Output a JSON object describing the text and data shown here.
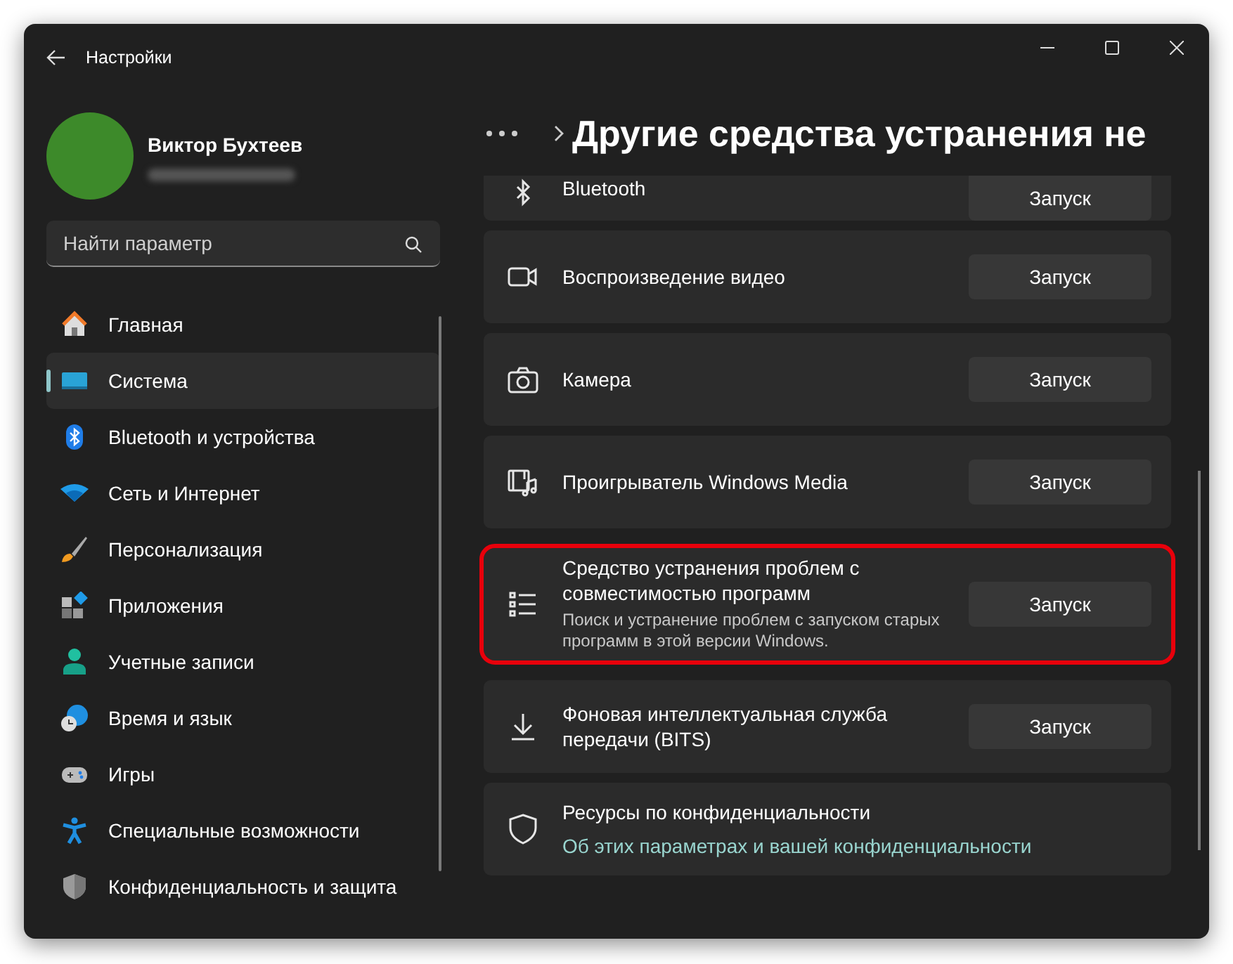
{
  "window": {
    "title": "Настройки"
  },
  "profile": {
    "name": "Виктор Бухтеев"
  },
  "search": {
    "placeholder": "Найти параметр"
  },
  "nav": [
    {
      "label": "Главная",
      "selected": false
    },
    {
      "label": "Система",
      "selected": true
    },
    {
      "label": "Bluetooth и устройства",
      "selected": false
    },
    {
      "label": "Сеть и Интернет",
      "selected": false
    },
    {
      "label": "Персонализация",
      "selected": false
    },
    {
      "label": "Приложения",
      "selected": false
    },
    {
      "label": "Учетные записи",
      "selected": false
    },
    {
      "label": "Время и язык",
      "selected": false
    },
    {
      "label": "Игры",
      "selected": false
    },
    {
      "label": "Специальные возможности",
      "selected": false
    },
    {
      "label": "Конфиденциальность и защита",
      "selected": false
    }
  ],
  "page_title": "Другие средства устранения не",
  "troubleshooters": [
    {
      "kind": "run",
      "title": "Bluetooth",
      "button": "Запуск",
      "highlighted": false
    },
    {
      "kind": "run",
      "title": "Воспроизведение видео",
      "button": "Запуск",
      "highlighted": false
    },
    {
      "kind": "run",
      "title": "Камера",
      "button": "Запуск",
      "highlighted": false
    },
    {
      "kind": "run",
      "title": "Проигрыватель Windows Media",
      "button": "Запуск",
      "highlighted": false
    },
    {
      "kind": "run",
      "title": "Средство устранения проблем с совместимостью программ",
      "description": "Поиск и устранение проблем с запуском старых программ в этой версии Windows.",
      "button": "Запуск",
      "highlighted": true
    },
    {
      "kind": "run",
      "title": "Фоновая интеллектуальная служба передачи (BITS)",
      "button": "Запуск",
      "highlighted": false
    },
    {
      "kind": "link",
      "title": "Ресурсы по конфиденциальности",
      "link": "Об этих параметрах и вашей конфиденциальности",
      "highlighted": false
    }
  ]
}
